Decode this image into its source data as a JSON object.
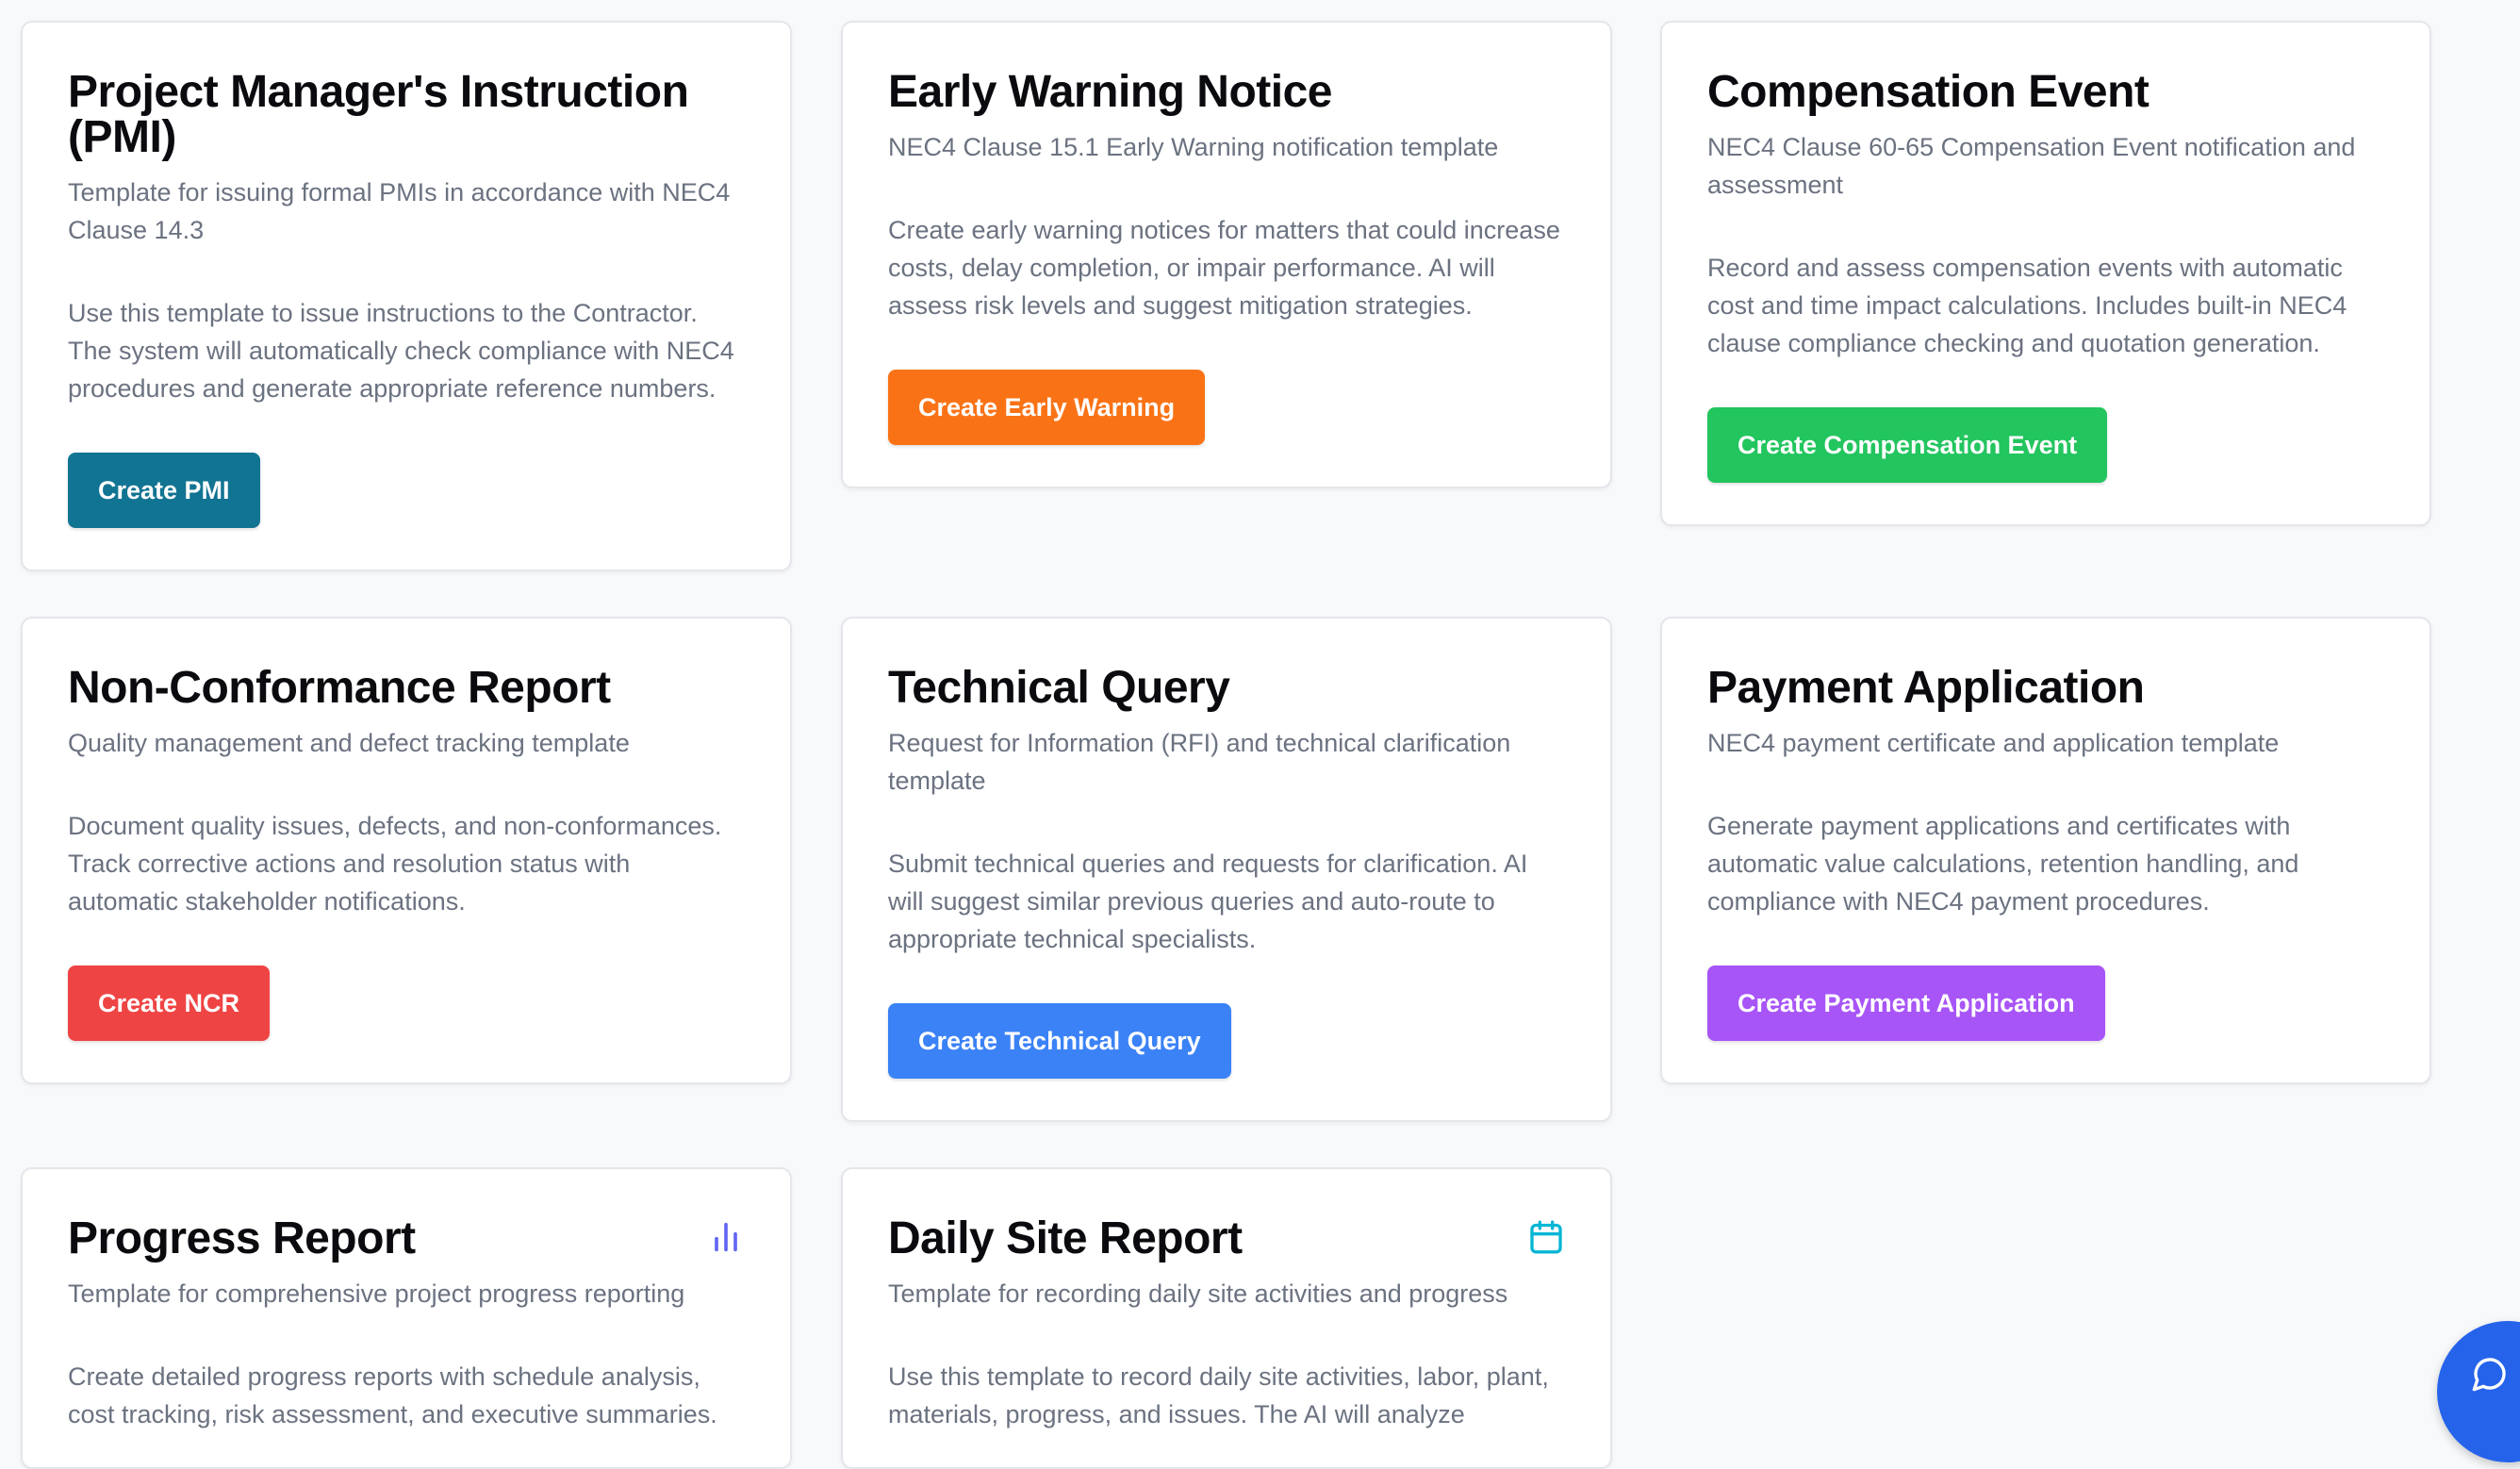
{
  "cards": [
    {
      "title": "Project Manager's Instruction (PMI)",
      "subtitle": "Template for issuing formal PMIs in accordance with NEC4 Clause 14.3",
      "description": "Use this template to issue instructions to the Contractor. The system will automatically check compliance with NEC4 procedures and generate appropriate reference numbers.",
      "button": "Create PMI",
      "button_color": "#127493"
    },
    {
      "title": "Early Warning Notice",
      "subtitle": "NEC4 Clause 15.1 Early Warning notification template",
      "description": "Create early warning notices for matters that could increase costs, delay completion, or impair performance. AI will assess risk levels and suggest mitigation strategies.",
      "button": "Create Early Warning",
      "button_color": "#f97316"
    },
    {
      "title": "Compensation Event",
      "subtitle": "NEC4 Clause 60-65 Compensation Event notification and assessment",
      "description": "Record and assess compensation events with automatic cost and time impact calculations. Includes built-in NEC4 clause compliance checking and quotation generation.",
      "button": "Create Compensation Event",
      "button_color": "#22c55e"
    },
    {
      "title": "Non-Conformance Report",
      "subtitle": "Quality management and defect tracking template",
      "description": "Document quality issues, defects, and non-conformances. Track corrective actions and resolution status with automatic stakeholder notifications.",
      "button": "Create NCR",
      "button_color": "#ef4444"
    },
    {
      "title": "Technical Query",
      "subtitle": "Request for Information (RFI) and technical clarification template",
      "description": "Submit technical queries and requests for clarification. AI will suggest similar previous queries and auto-route to appropriate technical specialists.",
      "button": "Create Technical Query",
      "button_color": "#3b82f6"
    },
    {
      "title": "Payment Application",
      "subtitle": "NEC4 payment certificate and application template",
      "description": "Generate payment applications and certificates with automatic value calculations, retention handling, and compliance with NEC4 payment procedures.",
      "button": "Create Payment Application",
      "button_color": "#a855f7"
    },
    {
      "title": "Progress Report",
      "subtitle": "Template for comprehensive project progress reporting",
      "description": "Create detailed progress reports with schedule analysis, cost tracking, risk assessment, and executive summaries.",
      "icon": "bar-chart-icon",
      "icon_color": "#6366f1"
    },
    {
      "title": "Daily Site Report",
      "subtitle": "Template for recording daily site activities and progress",
      "description": "Use this template to record daily site activities, labor, plant, materials, progress, and issues. The AI will analyze",
      "icon": "calendar-icon",
      "icon_color": "#06b6d4"
    }
  ],
  "chat_button": {
    "icon": "chat-bubble-icon",
    "color": "#2563eb"
  }
}
